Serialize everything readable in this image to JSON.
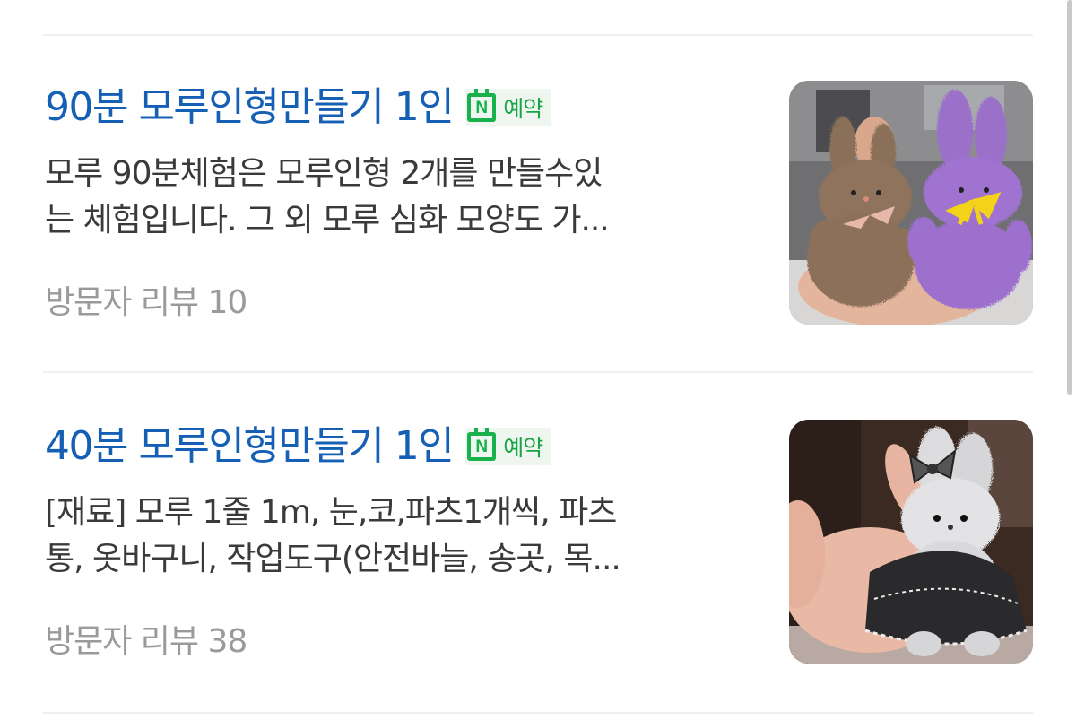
{
  "items": [
    {
      "title": "90분 모루인형만들기 1인",
      "badge": {
        "icon": "naver-booking-icon",
        "letter": "N",
        "label": "예약"
      },
      "desc_line1": "모루 90분체험은 모루인형 2개를 만들수있",
      "desc_line2": "는 체험입니다. 그 외 모루 심화 모양도 가...",
      "review": "방문자 리뷰 10"
    },
    {
      "title": "40분 모루인형만들기 1인",
      "badge": {
        "icon": "naver-booking-icon",
        "letter": "N",
        "label": "예약"
      },
      "desc_line1": "[재료] 모루 1줄 1m, 눈,코,파츠1개씩, 파츠",
      "desc_line2": "통, 옷바구니, 작업도구(안전바늘, 송곳, 목...",
      "review": "방문자 리뷰 38"
    }
  ],
  "colors": {
    "title": "#1560b5",
    "badge_green": "#19b14b",
    "review_gray": "#9a9a9a",
    "text": "#3a3a3a"
  }
}
